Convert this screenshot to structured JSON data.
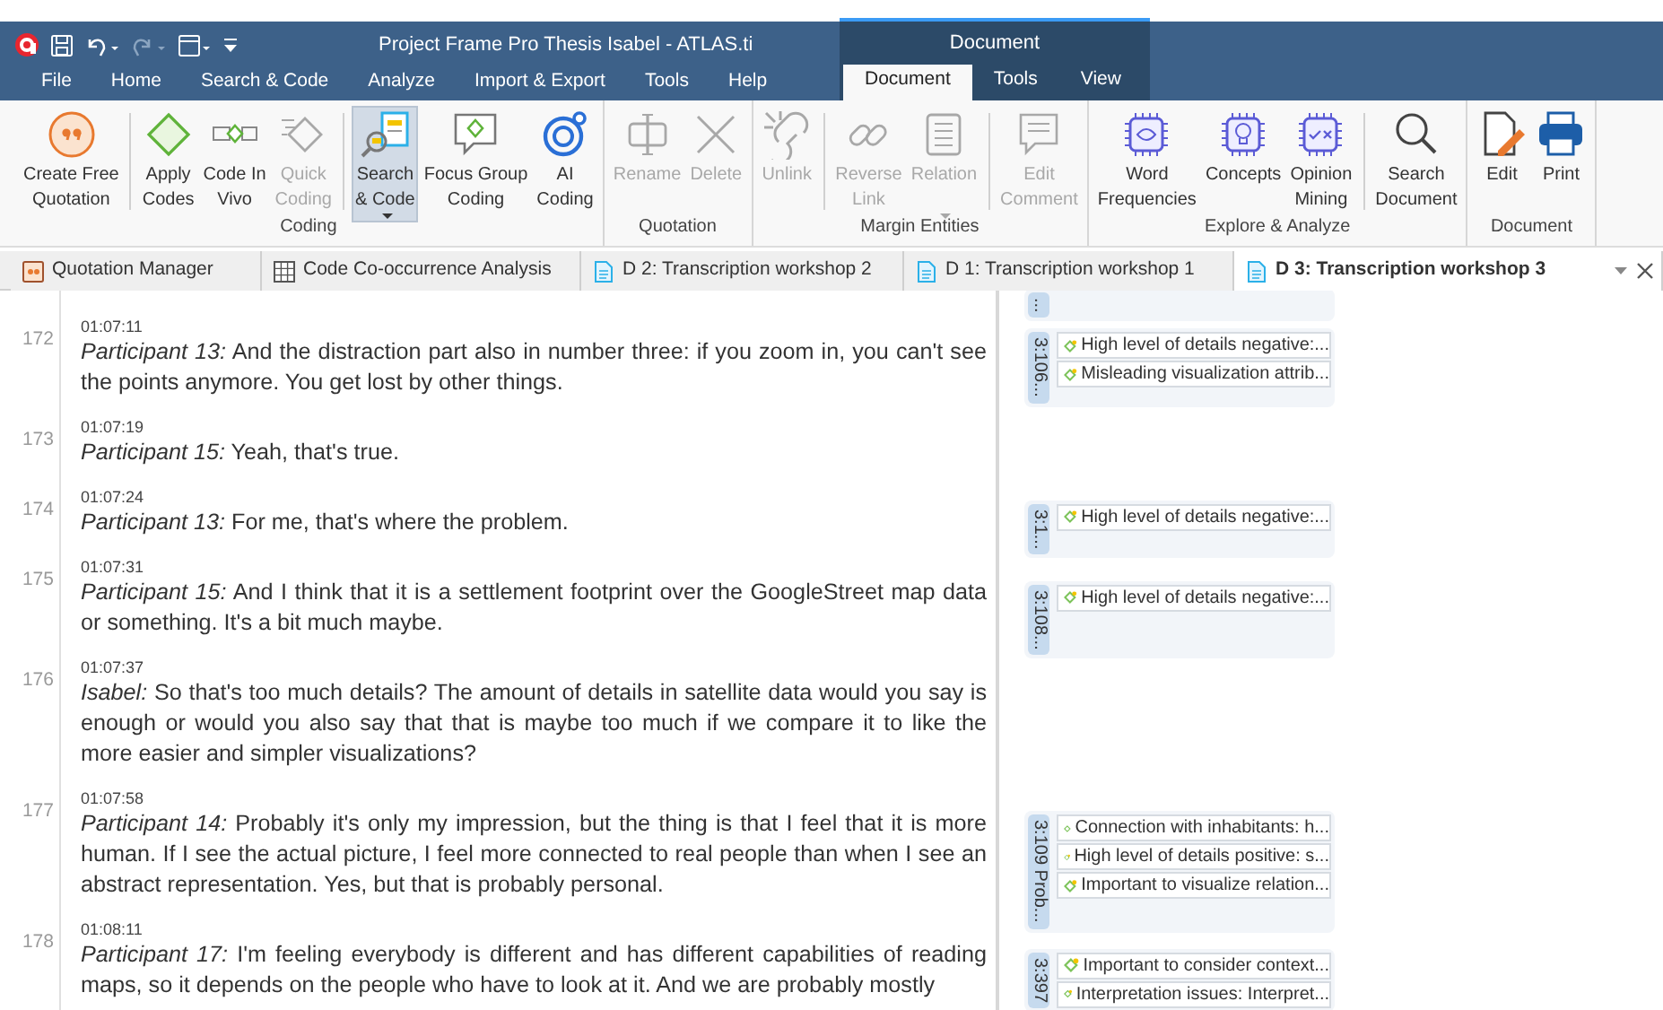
{
  "window": {
    "title": "Project Frame Pro Thesis Isabel - ATLAS.ti"
  },
  "menu_tabs": [
    {
      "label": "File",
      "selected": false
    },
    {
      "label": "Home",
      "selected": false
    },
    {
      "label": "Search & Code",
      "selected": false
    },
    {
      "label": "Analyze",
      "selected": false
    },
    {
      "label": "Import & Export",
      "selected": false
    },
    {
      "label": "Tools",
      "selected": false
    },
    {
      "label": "Help",
      "selected": false
    }
  ],
  "contextual_tab_group": {
    "title": "Document",
    "tabs": [
      {
        "label": "Document",
        "selected": true
      },
      {
        "label": "Tools",
        "selected": false
      },
      {
        "label": "View",
        "selected": false
      }
    ]
  },
  "ribbon_groups": [
    {
      "title": "Coding",
      "items": [
        {
          "kind": "button",
          "label": "Create Free\nQuotation",
          "disabled": false,
          "selected": false,
          "dropdown": false
        },
        {
          "kind": "separator"
        },
        {
          "kind": "button",
          "label": "Apply\nCodes",
          "disabled": false,
          "selected": false,
          "dropdown": false
        },
        {
          "kind": "button",
          "label": "Code In\nVivo",
          "disabled": false,
          "selected": false,
          "dropdown": false
        },
        {
          "kind": "button",
          "label": "Quick\nCoding",
          "disabled": true,
          "selected": false,
          "dropdown": false
        },
        {
          "kind": "separator"
        },
        {
          "kind": "button",
          "label": "Search\n& Code",
          "disabled": false,
          "selected": true,
          "dropdown": true
        },
        {
          "kind": "button",
          "label": "Focus Group\nCoding",
          "disabled": false,
          "selected": false,
          "dropdown": false
        },
        {
          "kind": "button",
          "label": "AI\nCoding",
          "disabled": false,
          "selected": false,
          "dropdown": false
        }
      ]
    },
    {
      "title": "Quotation",
      "items": [
        {
          "kind": "button",
          "label": "Rename",
          "disabled": true,
          "selected": false,
          "dropdown": false
        },
        {
          "kind": "button",
          "label": "Delete",
          "disabled": true,
          "selected": false,
          "dropdown": false
        }
      ]
    },
    {
      "title": "Margin Entities",
      "items": [
        {
          "kind": "button",
          "label": "Unlink",
          "disabled": true,
          "selected": false,
          "dropdown": false
        },
        {
          "kind": "separator"
        },
        {
          "kind": "button",
          "label": "Reverse\nLink",
          "disabled": true,
          "selected": false,
          "dropdown": false
        },
        {
          "kind": "button",
          "label": "Relation",
          "disabled": true,
          "selected": false,
          "dropdown": true
        },
        {
          "kind": "separator"
        },
        {
          "kind": "button",
          "label": "Edit\nComment",
          "disabled": true,
          "selected": false,
          "dropdown": false
        }
      ]
    },
    {
      "title": "Explore & Analyze",
      "items": [
        {
          "kind": "button",
          "label": "Word\nFrequencies",
          "disabled": false,
          "selected": false,
          "dropdown": false
        },
        {
          "kind": "button",
          "label": "Concepts",
          "disabled": false,
          "selected": false,
          "dropdown": false
        },
        {
          "kind": "button",
          "label": "Opinion\nMining",
          "disabled": false,
          "selected": false,
          "dropdown": false
        },
        {
          "kind": "separator"
        },
        {
          "kind": "button",
          "label": "Search\nDocument",
          "disabled": false,
          "selected": false,
          "dropdown": false
        }
      ]
    },
    {
      "title": "Document",
      "items": [
        {
          "kind": "button",
          "label": "Edit",
          "disabled": false,
          "selected": false,
          "dropdown": false
        },
        {
          "kind": "button",
          "label": "Print",
          "disabled": false,
          "selected": false,
          "dropdown": false
        }
      ]
    }
  ],
  "document_tabs": [
    {
      "label": "Quotation Manager",
      "selected": false
    },
    {
      "label": "Code Co-occurrence Analysis",
      "selected": false
    },
    {
      "label": "D 2: Transcription workshop 2",
      "selected": false
    },
    {
      "label": "D 1: Transcription workshop 1",
      "selected": false
    },
    {
      "label": "D 3: Transcription workshop 3",
      "selected": true
    }
  ],
  "transcript": [
    {
      "line": "172",
      "time": "01:07:11",
      "text": "*Participant 13:* And the distraction part also in number three: if you zoom in, you can't see the points anymore. You get lost by other things."
    },
    {
      "line": "173",
      "time": "01:07:19",
      "text": "*Participant 15:* Yeah, that's true."
    },
    {
      "line": "174",
      "time": "01:07:24",
      "text": "*Participant 13:* For me, that's where the problem."
    },
    {
      "line": "175",
      "time": "01:07:31",
      "text": "*Participant 15:* And I think that it is a settlement footprint over the GoogleStreet map data or something. It's a bit much maybe."
    },
    {
      "line": "176",
      "time": "01:07:37",
      "text": "*Isabel:* So that's too much details? The amount of details in satellite data would you say is enough or would you also say that that is maybe too much if we compare it to like the more easier and simpler visualizations?"
    },
    {
      "line": "177",
      "time": "01:07:58",
      "text": "*Participant 14:* Probably it's only my impression, but the thing is that I feel that it is more human. If I see the actual picture, I feel more connected to real people than when I see an abstract representation. Yes, but that is probably personal."
    },
    {
      "line": "178",
      "time": "01:08:11",
      "text": "*Participant 17:* I'm feeling everybody is different and has different capabilities of reading maps, so it depends on the people who have to look at it. And we are probably mostly"
    }
  ],
  "margin": [
    {
      "label": "..."
    },
    {
      "label": "3:106...",
      "codes": [
        {
          "kind": "commented",
          "label": "High level of details negative:..."
        },
        {
          "kind": "commented",
          "label": "Misleading visualization attrib..."
        }
      ]
    },
    {
      "label": "3:1...",
      "codes": [
        {
          "kind": "commented",
          "label": "High level of details negative:..."
        }
      ]
    },
    {
      "label": "3:108...",
      "codes": [
        {
          "kind": "commented",
          "label": "High level of details negative:..."
        }
      ]
    },
    {
      "label": "3:109 Prob...",
      "codes": [
        {
          "kind": "plain",
          "label": "Connection with inhabitants: h..."
        },
        {
          "kind": "commented",
          "label": "High level of details positive: s..."
        },
        {
          "kind": "commented",
          "label": "Important to visualize relation..."
        }
      ]
    },
    {
      "label": "3:397",
      "codes": [
        {
          "kind": "commented",
          "label": "Important to consider context..."
        },
        {
          "kind": "commented",
          "label": "Interpretation issues: Interpret..."
        }
      ]
    }
  ]
}
